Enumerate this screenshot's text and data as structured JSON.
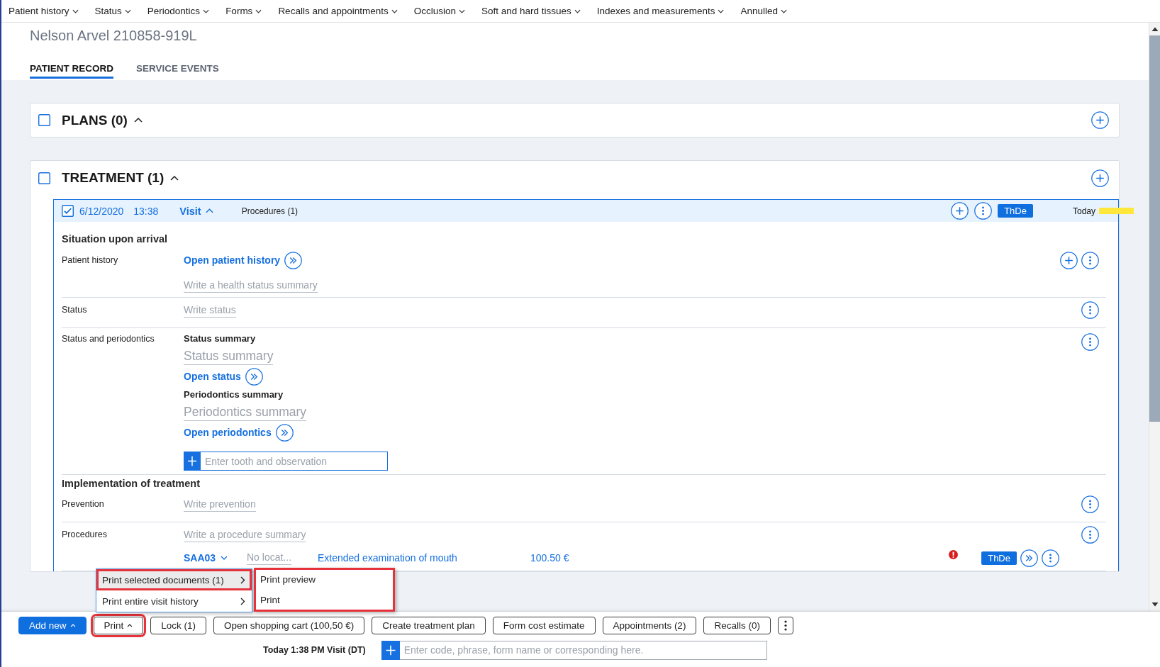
{
  "menu_bar": [
    "Patient history",
    "Status",
    "Periodontics",
    "Forms",
    "Recalls and appointments",
    "Occlusion",
    "Soft and hard tissues",
    "Indexes and measurements",
    "Annulled"
  ],
  "patient": {
    "name": "Nelson Arvel 210858-919L"
  },
  "tabs": [
    {
      "label": "PATIENT RECORD",
      "selected": true
    },
    {
      "label": "SERVICE EVENTS",
      "selected": false
    }
  ],
  "sections": [
    {
      "title": "PLANS (0)",
      "checked": false,
      "expanded": true
    },
    {
      "title": "TREATMENT (1)",
      "checked": false,
      "expanded": true,
      "visits": [
        {
          "checked": true,
          "date": "6/12/2020",
          "time": "13:38",
          "title": "Visit",
          "expanded": true,
          "procedures": "Procedures (1)",
          "badge": "ThDe",
          "day": "Today",
          "redacted": true,
          "groups": [
            {
              "heading": "Situation upon arrival",
              "rows": [
                {
                  "label": "Patient history",
                  "actions": [
                    {
                      "kind": "add"
                    },
                    {
                      "kind": "more"
                    }
                  ],
                  "items": [
                    {
                      "kind": "link",
                      "text": "Open patient history"
                    },
                    {
                      "kind": "field",
                      "placeholder": "Write a health status summary"
                    }
                  ]
                },
                {
                  "label": "Status",
                  "actions": [
                    {
                      "kind": "more"
                    }
                  ],
                  "items": [
                    {
                      "kind": "field",
                      "placeholder": "Write status"
                    }
                  ]
                },
                {
                  "label": "Status and periodontics",
                  "actions": [
                    {
                      "kind": "more"
                    }
                  ],
                  "items": [
                    {
                      "kind": "subheading",
                      "text": "Status summary"
                    },
                    {
                      "kind": "summary",
                      "placeholder": "Status summary"
                    },
                    {
                      "kind": "link",
                      "text": "Open status"
                    },
                    {
                      "kind": "subheading",
                      "text": "Periodontics summary"
                    },
                    {
                      "kind": "summary",
                      "placeholder": "Periodontics summary"
                    },
                    {
                      "kind": "link",
                      "text": "Open periodontics"
                    },
                    {
                      "kind": "entry",
                      "placeholder": "Enter tooth and observation"
                    }
                  ]
                }
              ]
            },
            {
              "heading": "Implementation of treatment",
              "rows": [
                {
                  "label": "Prevention",
                  "actions": [
                    {
                      "kind": "more"
                    }
                  ],
                  "items": [
                    {
                      "kind": "field",
                      "placeholder": "Write prevention"
                    }
                  ]
                },
                {
                  "label": "Procedures",
                  "actions": [
                    {
                      "kind": "more"
                    }
                  ],
                  "items": [
                    {
                      "kind": "field",
                      "placeholder": "Write a procedure summary"
                    },
                    {
                      "kind": "procedure",
                      "code": "SAA03",
                      "location_placeholder": "No locat...",
                      "description": "Extended examination of mouth",
                      "price": "100.50 €",
                      "error": true,
                      "badge": "ThDe"
                    }
                  ]
                }
              ]
            }
          ]
        }
      ]
    }
  ],
  "print_menu": {
    "items": [
      {
        "label": "Print selected documents (1)",
        "selected": true,
        "highlighted": true
      },
      {
        "label": "Print entire visit history",
        "selected": false,
        "highlighted": false
      }
    ],
    "submenu": {
      "highlighted": true,
      "items": [
        {
          "label": "Print preview"
        },
        {
          "label": "Print"
        }
      ]
    }
  },
  "toolbar": {
    "buttons": [
      {
        "kind": "primary",
        "label": "Add new",
        "dropdown": true,
        "highlighted": false
      },
      {
        "kind": "default",
        "label": "Print",
        "dropdown": true,
        "highlighted": true
      },
      {
        "kind": "default",
        "label": "Lock (1)",
        "dropdown": false,
        "highlighted": false
      },
      {
        "kind": "default",
        "label": "Open shopping cart (100,50 €)",
        "dropdown": false,
        "highlighted": false
      },
      {
        "kind": "default",
        "label": "Create treatment plan",
        "dropdown": false,
        "highlighted": false
      },
      {
        "kind": "default",
        "label": "Form cost estimate",
        "dropdown": false,
        "highlighted": false
      },
      {
        "kind": "default",
        "label": "Appointments (2)",
        "dropdown": false,
        "highlighted": false
      },
      {
        "kind": "default",
        "label": "Recalls (0)",
        "dropdown": false,
        "highlighted": false
      },
      {
        "kind": "more",
        "highlighted": false
      }
    ]
  },
  "status_line": {
    "text": "Today 1:38 PM Visit (DT)",
    "command_placeholder": "Enter code, phrase, form name or corresponding here."
  }
}
